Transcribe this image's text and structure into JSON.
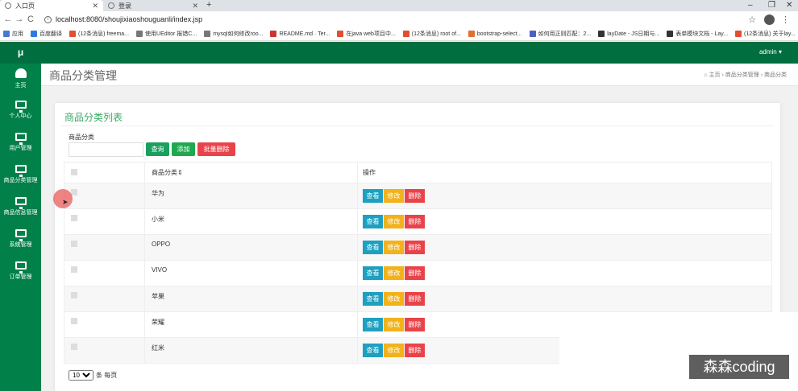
{
  "browser": {
    "tabs": [
      {
        "label": "入口页"
      },
      {
        "label": "登录"
      }
    ],
    "new_tab": "+",
    "win_min": "–",
    "win_max": "❐",
    "win_close": "✕",
    "url": "localhost:8080/shoujixiaoshouguanli/index.jsp",
    "bookmarks": [
      {
        "label": "应用",
        "color": "#4a78d0"
      },
      {
        "label": "百度翻译",
        "color": "#2d7be0"
      },
      {
        "label": "(12条消息) freema...",
        "color": "#e05030"
      },
      {
        "label": "使用UEditor 报错C...",
        "color": "#777777"
      },
      {
        "label": "mysql如何修改roo...",
        "color": "#777777"
      },
      {
        "label": "README.md · Ter...",
        "color": "#cc3333"
      },
      {
        "label": "在java web项目中...",
        "color": "#e05030"
      },
      {
        "label": "(12条消息) root of...",
        "color": "#e05030"
      },
      {
        "label": "bootstrap-select...",
        "color": "#e07030"
      },
      {
        "label": "如何用正则匹配：2...",
        "color": "#4a60c0"
      },
      {
        "label": "layDate - JS日期与...",
        "color": "#333333"
      },
      {
        "label": "表单模块文档 - Lay...",
        "color": "#333333"
      },
      {
        "label": "(12条消息) 关于lay...",
        "color": "#e05030"
      }
    ]
  },
  "sidebar": {
    "logo": "μ",
    "items": [
      {
        "label": "主页",
        "icon": "dashboard-icon"
      },
      {
        "label": "个人中心",
        "icon": "monitor-icon"
      },
      {
        "label": "用户管理",
        "icon": "monitor-icon"
      },
      {
        "label": "商品分类管理",
        "icon": "monitor-icon"
      },
      {
        "label": "商品信息管理",
        "icon": "monitor-icon"
      },
      {
        "label": "系统管理",
        "icon": "monitor-icon"
      },
      {
        "label": "订单管理",
        "icon": "monitor-icon"
      }
    ]
  },
  "header": {
    "user": "admin ▾"
  },
  "page": {
    "title": "商品分类管理",
    "breadcrumb": "⌂ 主页  ›  商品分类管理  ›  商品分类"
  },
  "card": {
    "title": "商品分类列表",
    "filter_label": "商品分类",
    "filter_value": "",
    "btn_search": "查询",
    "btn_add": "添加",
    "btn_batch_delete": "批量删除",
    "columns": {
      "category": "商品分类⇕",
      "actions": "操作"
    },
    "rows": [
      {
        "name": "华为"
      },
      {
        "name": "小米"
      },
      {
        "name": "OPPO"
      },
      {
        "name": "VIVO"
      },
      {
        "name": "苹果"
      },
      {
        "name": "荣耀"
      },
      {
        "name": "红米"
      }
    ],
    "action_labels": {
      "view": "查看",
      "edit": "修改",
      "delete": "删除"
    },
    "pager": {
      "per_page": "10",
      "suffix": "条 每页"
    }
  },
  "watermark": "森森coding",
  "colors": {
    "sidebar": "#01804a",
    "topbar": "#016e40",
    "accent": "#3aa864",
    "danger": "#e9434a",
    "warning": "#f2b21a",
    "info": "#1ea0c0"
  }
}
